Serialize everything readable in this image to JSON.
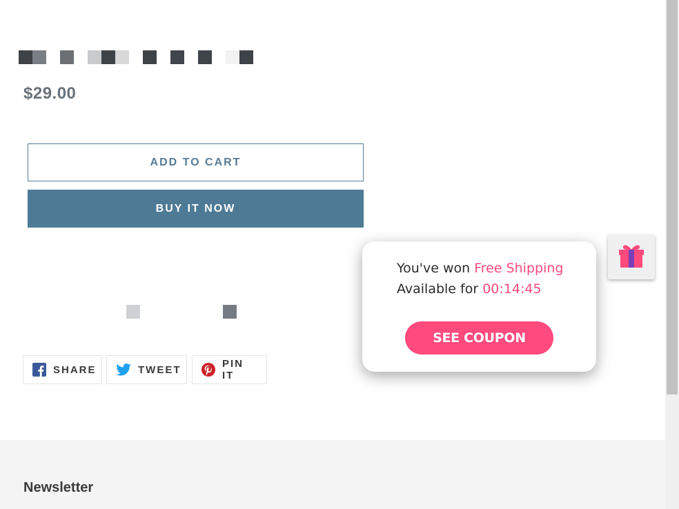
{
  "product": {
    "price": "$29.00",
    "swatches": [
      {
        "name": "swatch-1",
        "colors": [
          "#3f4247",
          "#7a7f84"
        ]
      },
      {
        "name": "swatch-2",
        "colors": [
          "#6c7075"
        ]
      },
      {
        "name": "swatch-3",
        "colors": [
          "#c9cacc",
          "#3e4348",
          "#d8d8d8"
        ]
      },
      {
        "name": "swatch-4",
        "colors": [
          "#3e4348"
        ]
      },
      {
        "name": "swatch-5",
        "colors": [
          "#40464c"
        ]
      },
      {
        "name": "swatch-6",
        "colors": [
          "#3f4449"
        ]
      },
      {
        "name": "swatch-7",
        "colors": [
          "#f2f2f2",
          "#3e4348"
        ]
      }
    ],
    "add_to_cart_label": "ADD TO CART",
    "buy_now_label": "BUY IT NOW",
    "thumbnails": [
      {
        "color": "#cfd1d4"
      },
      {
        "color": "#767c83"
      }
    ]
  },
  "share": {
    "facebook_label": "SHARE",
    "twitter_label": "TWEET",
    "pinterest_label": "PIN IT",
    "facebook_color": "#3b5998",
    "twitter_color": "#1fa1f1",
    "pinterest_color": "#cb2127"
  },
  "footer": {
    "newsletter_title": "Newsletter"
  },
  "popup": {
    "won_prefix": "You've won ",
    "won_prize": "Free Shipping",
    "available_prefix": "Available for ",
    "countdown": "00:14:45",
    "see_coupon_label": "SEE COUPON",
    "accent_color": "#ff4a7e"
  },
  "gift_launcher": {
    "icon": "gift-icon"
  }
}
